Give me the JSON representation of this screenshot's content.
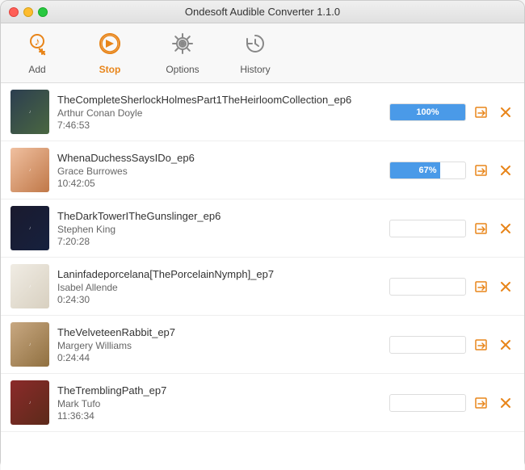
{
  "window": {
    "title": "Ondesoft Audible Converter 1.1.0"
  },
  "toolbar": {
    "items": [
      {
        "id": "add",
        "label": "Add",
        "icon": "add",
        "active": false
      },
      {
        "id": "stop",
        "label": "Stop",
        "icon": "stop",
        "active": true
      },
      {
        "id": "options",
        "label": "Options",
        "icon": "options",
        "active": false
      },
      {
        "id": "history",
        "label": "History",
        "icon": "history",
        "active": false
      }
    ]
  },
  "books": [
    {
      "id": 1,
      "title": "TheCompleteSherlockHolmesPart1TheHeirloomCollection_ep6",
      "author": "Arthur Conan Doyle",
      "duration": "7:46:53",
      "progress": 100,
      "progressLabel": "100%",
      "cover": "1"
    },
    {
      "id": 2,
      "title": "WhenaDuchessSaysIDo_ep6",
      "author": "Grace Burrowes",
      "duration": "10:42:05",
      "progress": 67,
      "progressLabel": "67%",
      "cover": "2"
    },
    {
      "id": 3,
      "title": "TheDarkTowerITheGunslinger_ep6",
      "author": "Stephen King",
      "duration": "7:20:28",
      "progress": 0,
      "progressLabel": "",
      "cover": "3"
    },
    {
      "id": 4,
      "title": "Laninfadeporcelana[ThePorcelainNymph]_ep7",
      "author": "Isabel Allende",
      "duration": "0:24:30",
      "progress": 0,
      "progressLabel": "",
      "cover": "4"
    },
    {
      "id": 5,
      "title": "TheVelveteenRabbit_ep7",
      "author": "Margery Williams",
      "duration": "0:24:44",
      "progress": 0,
      "progressLabel": "",
      "cover": "5"
    },
    {
      "id": 6,
      "title": "TheTremblingPath_ep7",
      "author": "Mark Tufo",
      "duration": "11:36:34",
      "progress": 0,
      "progressLabel": "",
      "cover": "6"
    }
  ],
  "actions": {
    "open_label": "⬡",
    "close_label": "✕"
  }
}
